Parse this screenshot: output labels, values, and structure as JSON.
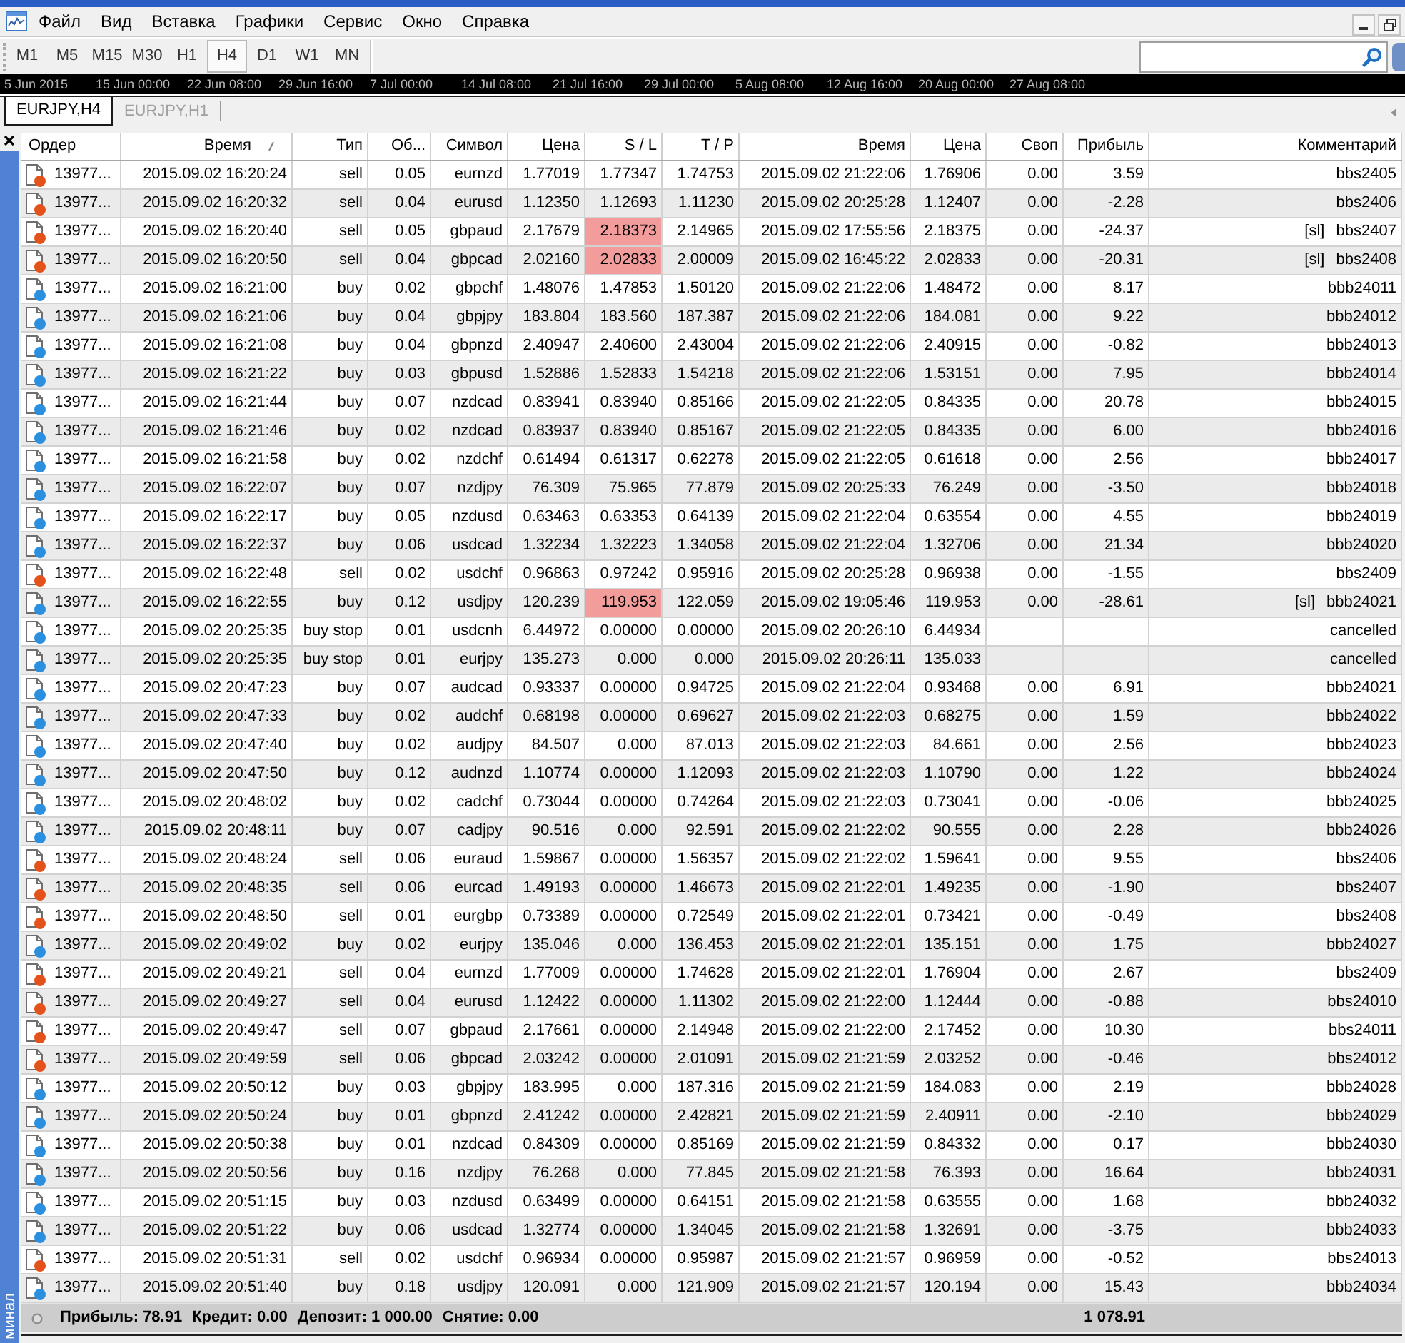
{
  "menu": [
    {
      "label": "Файл"
    },
    {
      "label": "Вид"
    },
    {
      "label": "Вставка"
    },
    {
      "label": "Графики"
    },
    {
      "label": "Сервис"
    },
    {
      "label": "Окно"
    },
    {
      "label": "Справка"
    }
  ],
  "timeframes": [
    {
      "label": "M1",
      "selected": false
    },
    {
      "label": "M5",
      "selected": false
    },
    {
      "label": "M15",
      "selected": false
    },
    {
      "label": "M30",
      "selected": false
    },
    {
      "label": "H1",
      "selected": false
    },
    {
      "label": "H4",
      "selected": true
    },
    {
      "label": "D1",
      "selected": false
    },
    {
      "label": "W1",
      "selected": false
    },
    {
      "label": "MN",
      "selected": false
    }
  ],
  "time_axis": [
    "5 Jun 2015",
    "15 Jun 00:00",
    "22 Jun 08:00",
    "29 Jun 16:00",
    "7 Jul 00:00",
    "14 Jul 08:00",
    "21 Jul 16:00",
    "29 Jul 00:00",
    "5 Aug 08:00",
    "12 Aug 16:00",
    "20 Aug 00:00",
    "27 Aug 08:00"
  ],
  "chart_tabs": [
    {
      "label": "EURJPY,H4",
      "selected": true
    },
    {
      "label": "EURJPY,H1",
      "selected": false
    }
  ],
  "terminal": {
    "side_title": "минал",
    "columns": [
      {
        "label": "Ордер",
        "sorted": false
      },
      {
        "label": "Время",
        "sorted": true
      },
      {
        "label": "Тип",
        "sorted": false
      },
      {
        "label": "Об...",
        "sorted": false
      },
      {
        "label": "Символ",
        "sorted": false
      },
      {
        "label": "Цена",
        "sorted": false
      },
      {
        "label": "S / L",
        "sorted": false
      },
      {
        "label": "T / P",
        "sorted": false
      },
      {
        "label": "Время",
        "sorted": false
      },
      {
        "label": "Цена",
        "sorted": false
      },
      {
        "label": "Своп",
        "sorted": false
      },
      {
        "label": "Прибыль",
        "sorted": false
      },
      {
        "label": "Комментарий",
        "sorted": false
      }
    ],
    "rows": [
      {
        "order": "13977...",
        "open_time": "2015.09.02 16:20:24",
        "type": "sell",
        "size": "0.05",
        "symbol": "eurnzd",
        "price": "1.77019",
        "sl": "1.77347",
        "tp": "1.74753",
        "close_time": "2015.09.02 21:22:06",
        "close_price": "1.76906",
        "swap": "0.00",
        "profit": "3.59",
        "comment": "bbs2405",
        "color": "#e4521b",
        "sl_hit": false
      },
      {
        "order": "13977...",
        "open_time": "2015.09.02 16:20:32",
        "type": "sell",
        "size": "0.04",
        "symbol": "eurusd",
        "price": "1.12350",
        "sl": "1.12693",
        "tp": "1.11230",
        "close_time": "2015.09.02 20:25:28",
        "close_price": "1.12407",
        "swap": "0.00",
        "profit": "-2.28",
        "comment": "bbs2406",
        "color": "#e4521b",
        "sl_hit": false
      },
      {
        "order": "13977...",
        "open_time": "2015.09.02 16:20:40",
        "type": "sell",
        "size": "0.05",
        "symbol": "gbpaud",
        "price": "2.17679",
        "sl": "2.18373",
        "tp": "2.14965",
        "close_time": "2015.09.02 17:55:56",
        "close_price": "2.18375",
        "swap": "0.00",
        "profit": "-24.37",
        "comment": "[sl] bbs2407",
        "color": "#e4521b",
        "sl_hit": true
      },
      {
        "order": "13977...",
        "open_time": "2015.09.02 16:20:50",
        "type": "sell",
        "size": "0.04",
        "symbol": "gbpcad",
        "price": "2.02160",
        "sl": "2.02833",
        "tp": "2.00009",
        "close_time": "2015.09.02 16:45:22",
        "close_price": "2.02833",
        "swap": "0.00",
        "profit": "-20.31",
        "comment": "[sl] bbs2408",
        "color": "#e4521b",
        "sl_hit": true
      },
      {
        "order": "13977...",
        "open_time": "2015.09.02 16:21:00",
        "type": "buy",
        "size": "0.02",
        "symbol": "gbpchf",
        "price": "1.48076",
        "sl": "1.47853",
        "tp": "1.50120",
        "close_time": "2015.09.02 21:22:06",
        "close_price": "1.48472",
        "swap": "0.00",
        "profit": "8.17",
        "comment": "bbb24011",
        "color": "#2b8fe0",
        "sl_hit": false
      },
      {
        "order": "13977...",
        "open_time": "2015.09.02 16:21:06",
        "type": "buy",
        "size": "0.04",
        "symbol": "gbpjpy",
        "price": "183.804",
        "sl": "183.560",
        "tp": "187.387",
        "close_time": "2015.09.02 21:22:06",
        "close_price": "184.081",
        "swap": "0.00",
        "profit": "9.22",
        "comment": "bbb24012",
        "color": "#2b8fe0",
        "sl_hit": false
      },
      {
        "order": "13977...",
        "open_time": "2015.09.02 16:21:08",
        "type": "buy",
        "size": "0.04",
        "symbol": "gbpnzd",
        "price": "2.40947",
        "sl": "2.40600",
        "tp": "2.43004",
        "close_time": "2015.09.02 21:22:06",
        "close_price": "2.40915",
        "swap": "0.00",
        "profit": "-0.82",
        "comment": "bbb24013",
        "color": "#2b8fe0",
        "sl_hit": false
      },
      {
        "order": "13977...",
        "open_time": "2015.09.02 16:21:22",
        "type": "buy",
        "size": "0.03",
        "symbol": "gbpusd",
        "price": "1.52886",
        "sl": "1.52833",
        "tp": "1.54218",
        "close_time": "2015.09.02 21:22:06",
        "close_price": "1.53151",
        "swap": "0.00",
        "profit": "7.95",
        "comment": "bbb24014",
        "color": "#2b8fe0",
        "sl_hit": false
      },
      {
        "order": "13977...",
        "open_time": "2015.09.02 16:21:44",
        "type": "buy",
        "size": "0.07",
        "symbol": "nzdcad",
        "price": "0.83941",
        "sl": "0.83940",
        "tp": "0.85166",
        "close_time": "2015.09.02 21:22:05",
        "close_price": "0.84335",
        "swap": "0.00",
        "profit": "20.78",
        "comment": "bbb24015",
        "color": "#2b8fe0",
        "sl_hit": false
      },
      {
        "order": "13977...",
        "open_time": "2015.09.02 16:21:46",
        "type": "buy",
        "size": "0.02",
        "symbol": "nzdcad",
        "price": "0.83937",
        "sl": "0.83940",
        "tp": "0.85167",
        "close_time": "2015.09.02 21:22:05",
        "close_price": "0.84335",
        "swap": "0.00",
        "profit": "6.00",
        "comment": "bbb24016",
        "color": "#2b8fe0",
        "sl_hit": false
      },
      {
        "order": "13977...",
        "open_time": "2015.09.02 16:21:58",
        "type": "buy",
        "size": "0.02",
        "symbol": "nzdchf",
        "price": "0.61494",
        "sl": "0.61317",
        "tp": "0.62278",
        "close_time": "2015.09.02 21:22:05",
        "close_price": "0.61618",
        "swap": "0.00",
        "profit": "2.56",
        "comment": "bbb24017",
        "color": "#2b8fe0",
        "sl_hit": false
      },
      {
        "order": "13977...",
        "open_time": "2015.09.02 16:22:07",
        "type": "buy",
        "size": "0.07",
        "symbol": "nzdjpy",
        "price": "76.309",
        "sl": "75.965",
        "tp": "77.879",
        "close_time": "2015.09.02 20:25:33",
        "close_price": "76.249",
        "swap": "0.00",
        "profit": "-3.50",
        "comment": "bbb24018",
        "color": "#2b8fe0",
        "sl_hit": false
      },
      {
        "order": "13977...",
        "open_time": "2015.09.02 16:22:17",
        "type": "buy",
        "size": "0.05",
        "symbol": "nzdusd",
        "price": "0.63463",
        "sl": "0.63353",
        "tp": "0.64139",
        "close_time": "2015.09.02 21:22:04",
        "close_price": "0.63554",
        "swap": "0.00",
        "profit": "4.55",
        "comment": "bbb24019",
        "color": "#2b8fe0",
        "sl_hit": false
      },
      {
        "order": "13977...",
        "open_time": "2015.09.02 16:22:37",
        "type": "buy",
        "size": "0.06",
        "symbol": "usdcad",
        "price": "1.32234",
        "sl": "1.32223",
        "tp": "1.34058",
        "close_time": "2015.09.02 21:22:04",
        "close_price": "1.32706",
        "swap": "0.00",
        "profit": "21.34",
        "comment": "bbb24020",
        "color": "#2b8fe0",
        "sl_hit": false
      },
      {
        "order": "13977...",
        "open_time": "2015.09.02 16:22:48",
        "type": "sell",
        "size": "0.02",
        "symbol": "usdchf",
        "price": "0.96863",
        "sl": "0.97242",
        "tp": "0.95916",
        "close_time": "2015.09.02 20:25:28",
        "close_price": "0.96938",
        "swap": "0.00",
        "profit": "-1.55",
        "comment": "bbs2409",
        "color": "#e4521b",
        "sl_hit": false
      },
      {
        "order": "13977...",
        "open_time": "2015.09.02 16:22:55",
        "type": "buy",
        "size": "0.12",
        "symbol": "usdjpy",
        "price": "120.239",
        "sl": "119.953",
        "tp": "122.059",
        "close_time": "2015.09.02 19:05:46",
        "close_price": "119.953",
        "swap": "0.00",
        "profit": "-28.61",
        "comment": "[sl] bbb24021",
        "color": "#2b8fe0",
        "sl_hit": true
      },
      {
        "order": "13977...",
        "open_time": "2015.09.02 20:25:35",
        "type": "buy stop",
        "size": "0.01",
        "symbol": "usdcnh",
        "price": "6.44972",
        "sl": "0.00000",
        "tp": "0.00000",
        "close_time": "2015.09.02 20:26:10",
        "close_price": "6.44934",
        "comment": "cancelled",
        "color": "#2b8fe0",
        "sl_hit": false
      },
      {
        "order": "13977...",
        "open_time": "2015.09.02 20:25:35",
        "type": "buy stop",
        "size": "0.01",
        "symbol": "eurjpy",
        "price": "135.273",
        "sl": "0.000",
        "tp": "0.000",
        "close_time": "2015.09.02 20:26:11",
        "close_price": "135.033",
        "comment": "cancelled",
        "color": "#2b8fe0",
        "sl_hit": false
      },
      {
        "order": "13977...",
        "open_time": "2015.09.02 20:47:23",
        "type": "buy",
        "size": "0.07",
        "symbol": "audcad",
        "price": "0.93337",
        "sl": "0.00000",
        "tp": "0.94725",
        "close_time": "2015.09.02 21:22:04",
        "close_price": "0.93468",
        "swap": "0.00",
        "profit": "6.91",
        "comment": "bbb24021",
        "color": "#2b8fe0",
        "sl_hit": false
      },
      {
        "order": "13977...",
        "open_time": "2015.09.02 20:47:33",
        "type": "buy",
        "size": "0.02",
        "symbol": "audchf",
        "price": "0.68198",
        "sl": "0.00000",
        "tp": "0.69627",
        "close_time": "2015.09.02 21:22:03",
        "close_price": "0.68275",
        "swap": "0.00",
        "profit": "1.59",
        "comment": "bbb24022",
        "color": "#2b8fe0",
        "sl_hit": false
      },
      {
        "order": "13977...",
        "open_time": "2015.09.02 20:47:40",
        "type": "buy",
        "size": "0.02",
        "symbol": "audjpy",
        "price": "84.507",
        "sl": "0.000",
        "tp": "87.013",
        "close_time": "2015.09.02 21:22:03",
        "close_price": "84.661",
        "swap": "0.00",
        "profit": "2.56",
        "comment": "bbb24023",
        "color": "#2b8fe0",
        "sl_hit": false
      },
      {
        "order": "13977...",
        "open_time": "2015.09.02 20:47:50",
        "type": "buy",
        "size": "0.12",
        "symbol": "audnzd",
        "price": "1.10774",
        "sl": "0.00000",
        "tp": "1.12093",
        "close_time": "2015.09.02 21:22:03",
        "close_price": "1.10790",
        "swap": "0.00",
        "profit": "1.22",
        "comment": "bbb24024",
        "color": "#2b8fe0",
        "sl_hit": false
      },
      {
        "order": "13977...",
        "open_time": "2015.09.02 20:48:02",
        "type": "buy",
        "size": "0.02",
        "symbol": "cadchf",
        "price": "0.73044",
        "sl": "0.00000",
        "tp": "0.74264",
        "close_time": "2015.09.02 21:22:03",
        "close_price": "0.73041",
        "swap": "0.00",
        "profit": "-0.06",
        "comment": "bbb24025",
        "color": "#2b8fe0",
        "sl_hit": false
      },
      {
        "order": "13977...",
        "open_time": "2015.09.02 20:48:11",
        "type": "buy",
        "size": "0.07",
        "symbol": "cadjpy",
        "price": "90.516",
        "sl": "0.000",
        "tp": "92.591",
        "close_time": "2015.09.02 21:22:02",
        "close_price": "90.555",
        "swap": "0.00",
        "profit": "2.28",
        "comment": "bbb24026",
        "color": "#2b8fe0",
        "sl_hit": false
      },
      {
        "order": "13977...",
        "open_time": "2015.09.02 20:48:24",
        "type": "sell",
        "size": "0.06",
        "symbol": "euraud",
        "price": "1.59867",
        "sl": "0.00000",
        "tp": "1.56357",
        "close_time": "2015.09.02 21:22:02",
        "close_price": "1.59641",
        "swap": "0.00",
        "profit": "9.55",
        "comment": "bbs2406",
        "color": "#e4521b",
        "sl_hit": false
      },
      {
        "order": "13977...",
        "open_time": "2015.09.02 20:48:35",
        "type": "sell",
        "size": "0.06",
        "symbol": "eurcad",
        "price": "1.49193",
        "sl": "0.00000",
        "tp": "1.46673",
        "close_time": "2015.09.02 21:22:01",
        "close_price": "1.49235",
        "swap": "0.00",
        "profit": "-1.90",
        "comment": "bbs2407",
        "color": "#e4521b",
        "sl_hit": false
      },
      {
        "order": "13977...",
        "open_time": "2015.09.02 20:48:50",
        "type": "sell",
        "size": "0.01",
        "symbol": "eurgbp",
        "price": "0.73389",
        "sl": "0.00000",
        "tp": "0.72549",
        "close_time": "2015.09.02 21:22:01",
        "close_price": "0.73421",
        "swap": "0.00",
        "profit": "-0.49",
        "comment": "bbs2408",
        "color": "#e4521b",
        "sl_hit": false
      },
      {
        "order": "13977...",
        "open_time": "2015.09.02 20:49:02",
        "type": "buy",
        "size": "0.02",
        "symbol": "eurjpy",
        "price": "135.046",
        "sl": "0.000",
        "tp": "136.453",
        "close_time": "2015.09.02 21:22:01",
        "close_price": "135.151",
        "swap": "0.00",
        "profit": "1.75",
        "comment": "bbb24027",
        "color": "#2b8fe0",
        "sl_hit": false
      },
      {
        "order": "13977...",
        "open_time": "2015.09.02 20:49:21",
        "type": "sell",
        "size": "0.04",
        "symbol": "eurnzd",
        "price": "1.77009",
        "sl": "0.00000",
        "tp": "1.74628",
        "close_time": "2015.09.02 21:22:01",
        "close_price": "1.76904",
        "swap": "0.00",
        "profit": "2.67",
        "comment": "bbs2409",
        "color": "#e4521b",
        "sl_hit": false
      },
      {
        "order": "13977...",
        "open_time": "2015.09.02 20:49:27",
        "type": "sell",
        "size": "0.04",
        "symbol": "eurusd",
        "price": "1.12422",
        "sl": "0.00000",
        "tp": "1.11302",
        "close_time": "2015.09.02 21:22:00",
        "close_price": "1.12444",
        "swap": "0.00",
        "profit": "-0.88",
        "comment": "bbs24010",
        "color": "#e4521b",
        "sl_hit": false
      },
      {
        "order": "13977...",
        "open_time": "2015.09.02 20:49:47",
        "type": "sell",
        "size": "0.07",
        "symbol": "gbpaud",
        "price": "2.17661",
        "sl": "0.00000",
        "tp": "2.14948",
        "close_time": "2015.09.02 21:22:00",
        "close_price": "2.17452",
        "swap": "0.00",
        "profit": "10.30",
        "comment": "bbs24011",
        "color": "#e4521b",
        "sl_hit": false
      },
      {
        "order": "13977...",
        "open_time": "2015.09.02 20:49:59",
        "type": "sell",
        "size": "0.06",
        "symbol": "gbpcad",
        "price": "2.03242",
        "sl": "0.00000",
        "tp": "2.01091",
        "close_time": "2015.09.02 21:21:59",
        "close_price": "2.03252",
        "swap": "0.00",
        "profit": "-0.46",
        "comment": "bbs24012",
        "color": "#e4521b",
        "sl_hit": false
      },
      {
        "order": "13977...",
        "open_time": "2015.09.02 20:50:12",
        "type": "buy",
        "size": "0.03",
        "symbol": "gbpjpy",
        "price": "183.995",
        "sl": "0.000",
        "tp": "187.316",
        "close_time": "2015.09.02 21:21:59",
        "close_price": "184.083",
        "swap": "0.00",
        "profit": "2.19",
        "comment": "bbb24028",
        "color": "#2b8fe0",
        "sl_hit": false
      },
      {
        "order": "13977...",
        "open_time": "2015.09.02 20:50:24",
        "type": "buy",
        "size": "0.01",
        "symbol": "gbpnzd",
        "price": "2.41242",
        "sl": "0.00000",
        "tp": "2.42821",
        "close_time": "2015.09.02 21:21:59",
        "close_price": "2.40911",
        "swap": "0.00",
        "profit": "-2.10",
        "comment": "bbb24029",
        "color": "#2b8fe0",
        "sl_hit": false
      },
      {
        "order": "13977...",
        "open_time": "2015.09.02 20:50:38",
        "type": "buy",
        "size": "0.01",
        "symbol": "nzdcad",
        "price": "0.84309",
        "sl": "0.00000",
        "tp": "0.85169",
        "close_time": "2015.09.02 21:21:59",
        "close_price": "0.84332",
        "swap": "0.00",
        "profit": "0.17",
        "comment": "bbb24030",
        "color": "#2b8fe0",
        "sl_hit": false
      },
      {
        "order": "13977...",
        "open_time": "2015.09.02 20:50:56",
        "type": "buy",
        "size": "0.16",
        "symbol": "nzdjpy",
        "price": "76.268",
        "sl": "0.000",
        "tp": "77.845",
        "close_time": "2015.09.02 21:21:58",
        "close_price": "76.393",
        "swap": "0.00",
        "profit": "16.64",
        "comment": "bbb24031",
        "color": "#2b8fe0",
        "sl_hit": false
      },
      {
        "order": "13977...",
        "open_time": "2015.09.02 20:51:15",
        "type": "buy",
        "size": "0.03",
        "symbol": "nzdusd",
        "price": "0.63499",
        "sl": "0.00000",
        "tp": "0.64151",
        "close_time": "2015.09.02 21:21:58",
        "close_price": "0.63555",
        "swap": "0.00",
        "profit": "1.68",
        "comment": "bbb24032",
        "color": "#2b8fe0",
        "sl_hit": false
      },
      {
        "order": "13977...",
        "open_time": "2015.09.02 20:51:22",
        "type": "buy",
        "size": "0.06",
        "symbol": "usdcad",
        "price": "1.32774",
        "sl": "0.00000",
        "tp": "1.34045",
        "close_time": "2015.09.02 21:21:58",
        "close_price": "1.32691",
        "swap": "0.00",
        "profit": "-3.75",
        "comment": "bbb24033",
        "color": "#2b8fe0",
        "sl_hit": false
      },
      {
        "order": "13977...",
        "open_time": "2015.09.02 20:51:31",
        "type": "sell",
        "size": "0.02",
        "symbol": "usdchf",
        "price": "0.96934",
        "sl": "0.00000",
        "tp": "0.95987",
        "close_time": "2015.09.02 21:21:57",
        "close_price": "0.96959",
        "swap": "0.00",
        "profit": "-0.52",
        "comment": "bbs24013",
        "color": "#e4521b",
        "sl_hit": false
      },
      {
        "order": "13977...",
        "open_time": "2015.09.02 20:51:40",
        "type": "buy",
        "size": "0.18",
        "symbol": "usdjpy",
        "price": "120.091",
        "sl": "0.000",
        "tp": "121.909",
        "close_time": "2015.09.02 21:21:57",
        "close_price": "120.194",
        "swap": "0.00",
        "profit": "15.43",
        "comment": "bbb24034",
        "color": "#2b8fe0",
        "sl_hit": false
      }
    ],
    "summary": [
      "Прибыль: 78.91",
      "Кредит: 0.00",
      "Депозит: 1 000.00",
      "Снятие: 0.00"
    ],
    "total_profit": "1 078.91"
  }
}
